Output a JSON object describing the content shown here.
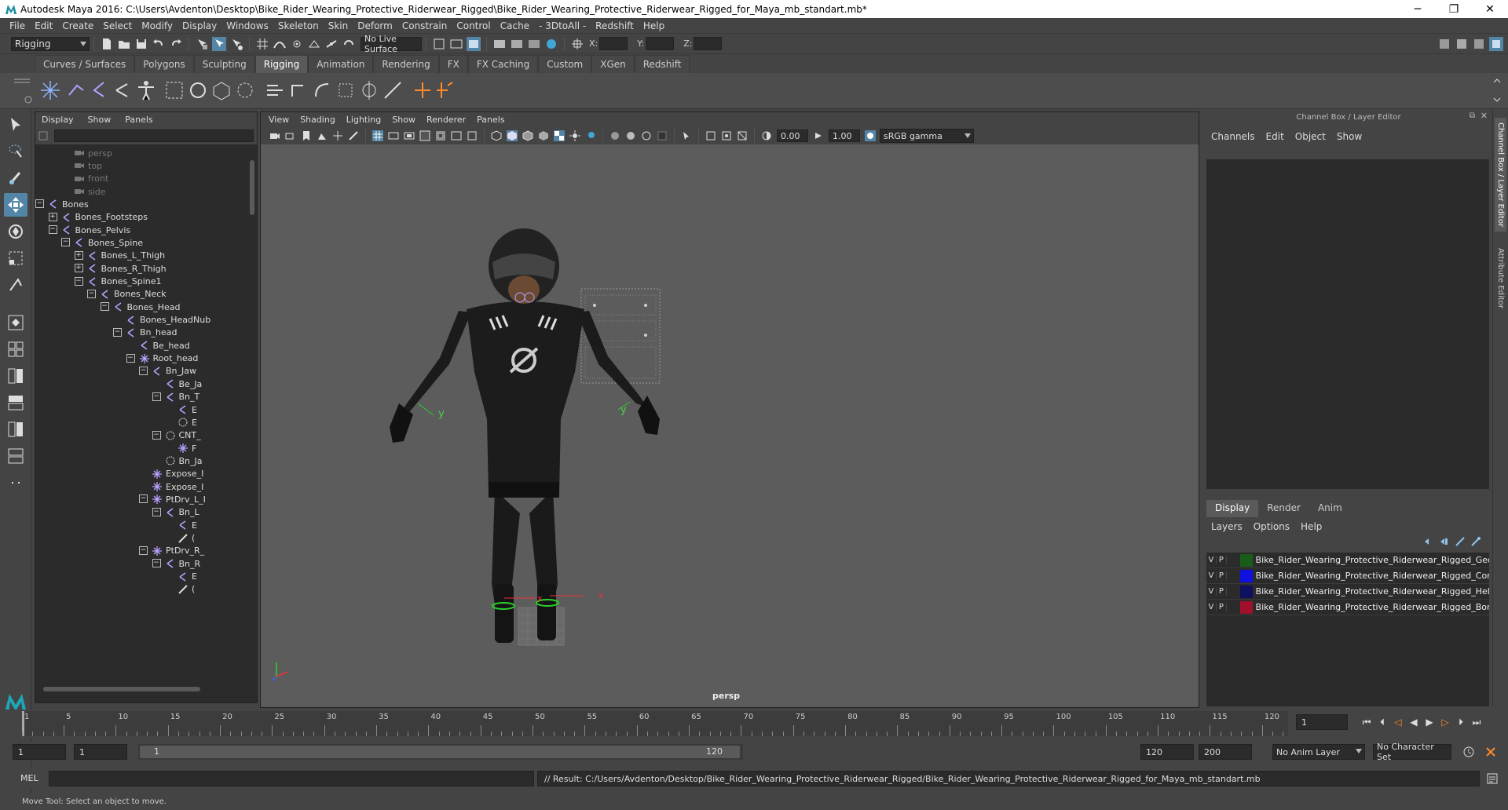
{
  "window": {
    "title": "Autodesk Maya 2016: C:\\Users\\Avdenton\\Desktop\\Bike_Rider_Wearing_Protective_Riderwear_Rigged\\Bike_Rider_Wearing_Protective_Riderwear_Rigged_for_Maya_mb_standart.mb*",
    "controls": [
      "─",
      "❐",
      "✕"
    ]
  },
  "menubar": [
    "File",
    "Edit",
    "Create",
    "Select",
    "Modify",
    "Display",
    "Windows",
    "Skeleton",
    "Skin",
    "Deform",
    "Constrain",
    "Control",
    "Cache",
    "- 3DtoAll -",
    "Redshift",
    "Help"
  ],
  "statusline": {
    "mode": "Rigging",
    "live_surface": "No Live Surface",
    "x_label": "X:",
    "y_label": "Y:",
    "z_label": "Z:"
  },
  "shelf_tabs": [
    "Curves / Surfaces",
    "Polygons",
    "Sculpting",
    "Rigging",
    "Animation",
    "Rendering",
    "FX",
    "FX Caching",
    "Custom",
    "XGen",
    "Redshift"
  ],
  "shelf_active": "Rigging",
  "outliner": {
    "menu": [
      "Display",
      "Show",
      "Panels"
    ],
    "nodes": [
      {
        "label": "persp",
        "dim": true
      },
      {
        "label": "top",
        "dim": true
      },
      {
        "label": "front",
        "dim": true
      },
      {
        "label": "side",
        "dim": true
      },
      {
        "label": "Bones"
      },
      {
        "label": "Bones_Footsteps"
      },
      {
        "label": "Bones_Pelvis"
      },
      {
        "label": "Bones_Spine"
      },
      {
        "label": "Bones_L_Thigh"
      },
      {
        "label": "Bones_R_Thigh"
      },
      {
        "label": "Bones_Spine1"
      },
      {
        "label": "Bones_Neck"
      },
      {
        "label": "Bones_Head"
      },
      {
        "label": "Bones_HeadNub"
      },
      {
        "label": "Bn_head"
      },
      {
        "label": "Be_head"
      },
      {
        "label": "Root_head"
      },
      {
        "label": "Bn_Jaw"
      },
      {
        "label": "Be_Ja"
      },
      {
        "label": "Bn_T"
      },
      {
        "label": "E"
      },
      {
        "label": "E"
      },
      {
        "label": "CNT_"
      },
      {
        "label": "F"
      },
      {
        "label": "Bn_Ja"
      },
      {
        "label": "Expose_I"
      },
      {
        "label": "Expose_I"
      },
      {
        "label": "PtDrv_L_I"
      },
      {
        "label": "Bn_L"
      },
      {
        "label": "E"
      },
      {
        "label": "("
      },
      {
        "label": "PtDrv_R_"
      },
      {
        "label": "Bn_R"
      },
      {
        "label": "E"
      },
      {
        "label": "("
      }
    ]
  },
  "viewport": {
    "menu": [
      "View",
      "Shading",
      "Lighting",
      "Show",
      "Renderer",
      "Panels"
    ],
    "exposure": "0.00",
    "gamma": "1.00",
    "color_space": "sRGB gamma",
    "camera_label": "persp",
    "axis_labels": {
      "y1": "y",
      "y2": "y",
      "x1": "x",
      "x2": "x"
    }
  },
  "channel_box": {
    "title": "Channel Box / Layer Editor",
    "menu": [
      "Channels",
      "Edit",
      "Object",
      "Show"
    ],
    "layer_tabs": [
      "Display",
      "Render",
      "Anim"
    ],
    "layer_active": "Display",
    "layer_menu": [
      "Layers",
      "Options",
      "Help"
    ],
    "layers": [
      {
        "v": "V",
        "p": "P",
        "color": "#1a5c1a",
        "name": "Bike_Rider_Wearing_Protective_Riderwear_Rigged_Geom"
      },
      {
        "v": "V",
        "p": "P",
        "color": "#1010e0",
        "name": "Bike_Rider_Wearing_Protective_Riderwear_Rigged_Contr"
      },
      {
        "v": "V",
        "p": "P",
        "color": "#101060",
        "name": "Bike_Rider_Wearing_Protective_Riderwear_Rigged_Helpe"
      },
      {
        "v": "V",
        "p": "P",
        "color": "#a0102a",
        "name": "Bike_Rider_Wearing_Protective_Riderwear_Rigged_Bones"
      }
    ]
  },
  "side_tabs": [
    "Channel Box / Layer Editor",
    "Attribute Editor"
  ],
  "timeline": {
    "ticks": [
      "1",
      "5",
      "10",
      "15",
      "20",
      "25",
      "30",
      "35",
      "40",
      "45",
      "50",
      "55",
      "60",
      "65",
      "70",
      "75",
      "80",
      "85",
      "90",
      "95",
      "100",
      "105",
      "110",
      "115",
      "120"
    ],
    "current_frame": "1",
    "play_buttons": [
      "⏮",
      "⏴",
      "◁",
      "◀",
      "▶",
      "▷",
      "⏵",
      "⏭"
    ]
  },
  "range": {
    "start": "1",
    "start2": "1",
    "slider_start": "1",
    "slider_end": "120",
    "end": "120",
    "end2": "200",
    "anim_layer": "No Anim Layer",
    "character_set": "No Character Set"
  },
  "command": {
    "lang": "MEL",
    "result": "// Result: C:/Users/Avdenton/Desktop/Bike_Rider_Wearing_Protective_Riderwear_Rigged/Bike_Rider_Wearing_Protective_Riderwear_Rigged_for_Maya_mb_standart.mb"
  },
  "status": "Move Tool: Select an object to move."
}
